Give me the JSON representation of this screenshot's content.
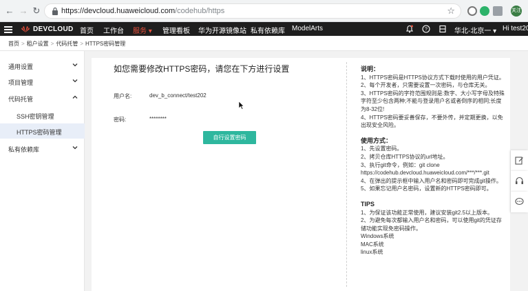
{
  "browser": {
    "url_host": "https://devcloud.",
    "url_domain": "huaweicloud.com",
    "url_path": "/codehub/https",
    "avatar_text": "关注"
  },
  "topnav": {
    "logo_text": "DEVCLOUD",
    "items": [
      "首页",
      "工作台",
      "服务",
      "管理看板",
      "华为开源镜像站",
      "私有依赖库",
      "ModelArts"
    ],
    "active_item": "服务",
    "region": "华北-北京一",
    "user": "Hi test202"
  },
  "breadcrumb": [
    "首页",
    "租户设置",
    "代码托管",
    "HTTPS密码管理"
  ],
  "sidebar": {
    "items": [
      {
        "label": "通用设置"
      },
      {
        "label": "项目管理"
      },
      {
        "label": "代码托管"
      },
      {
        "label": "SSH密钥管理"
      },
      {
        "label": "HTTPS密码管理"
      },
      {
        "label": "私有依赖库"
      }
    ]
  },
  "main": {
    "title": "如您需要修改HTTPS密码，请您在下方进行设置",
    "username_label": "用户名:",
    "username_value": "dev_b_connect/test202",
    "password_label": "密码:",
    "password_value": "********",
    "set_button": "自行设置密码"
  },
  "help": {
    "desc_title": "说明：",
    "desc_lines": [
      "1、HTTPS密码是HTTPS协议方式下载时使用的用户凭证。",
      "2、每个开发者，只需要设置一次密码，与仓库无关。",
      "3、HTTPS密码的字符范围规则是:数字、大小写字母及特殊字符至少包含两种;不能与登录用户名或者倒序的相同;长度为8-32位!",
      "4、HTTPS密码要妥善保存，不要外传，并定期更换，以免出现安全风险。"
    ],
    "usage_title": "使用方式：",
    "usage_lines": [
      "1、先设置密码。",
      "2、拷贝仓库HTTPS协议的url地址。",
      "3、执行git命令，例如：git clone https://codehub.devcloud.huaweicloud.com/***/***.git",
      "4、在弹出的提示框中输入用户名和密码即可完成git操作。",
      "5、如果忘记用户名密码，设置新的HTTPS密码即可。"
    ],
    "tips_title": "TIPS",
    "tips_lines": [
      "1、为保证该功能正常使用，建议安装git2.5以上版本。",
      "2、为避免每次都输入用户名和密码，可以使用git的凭证存储功能实现免密码操作。",
      "Windows系统",
      "MAC系统",
      "linux系统"
    ]
  },
  "colors": {
    "accent": "#2eb79e",
    "nav_bg": "#1e1e1e",
    "brand": "#e6503c",
    "active_side": "#e8eef8"
  }
}
